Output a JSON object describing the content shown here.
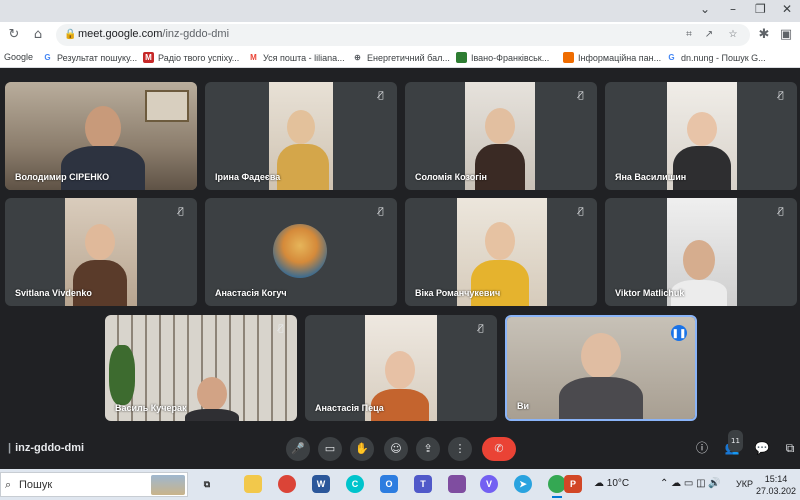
{
  "browser": {
    "url_host": "meet.google.com",
    "url_path": "/inz-gddo-dmi",
    "bookmarks": [
      {
        "label": "Google",
        "icon": "google-icon"
      },
      {
        "label": "Результат пошуку...",
        "icon": "google-icon"
      },
      {
        "label": "Радіо твого успіху...",
        "icon": "bookmark-m-icon"
      },
      {
        "label": "Уся пошта - liliana...",
        "icon": "gmail-icon"
      },
      {
        "label": "Енергетичний бал...",
        "icon": "globe-icon"
      },
      {
        "label": "Івано-Франківськ...",
        "icon": "bookmark-green-icon"
      },
      {
        "label": "Інформаційна пан...",
        "icon": "bookmark-orange-icon"
      },
      {
        "label": "dn.nung - Пошук G...",
        "icon": "google-icon"
      }
    ]
  },
  "meet": {
    "meeting_code": "inz-gddo-dmi",
    "participant_count": "11",
    "participants": [
      {
        "name": "Володимир СІРЕНКО"
      },
      {
        "name": "Ірина Фадеєва"
      },
      {
        "name": "Соломія Козогін"
      },
      {
        "name": "Яна Василишин"
      },
      {
        "name": "Svitlana Vivdenko"
      },
      {
        "name": "Анастасія Когуч"
      },
      {
        "name": "Віка Романчукевич"
      },
      {
        "name": "Viktor Matlichuk"
      },
      {
        "name": "Василь Кучерак"
      },
      {
        "name": "Анастасія Пеца"
      },
      {
        "name": "Ви"
      }
    ]
  },
  "taskbar": {
    "search_placeholder": "Пошук",
    "weather": "10°C",
    "language": "УКР",
    "time": "15:14",
    "date": "27.03.202"
  }
}
